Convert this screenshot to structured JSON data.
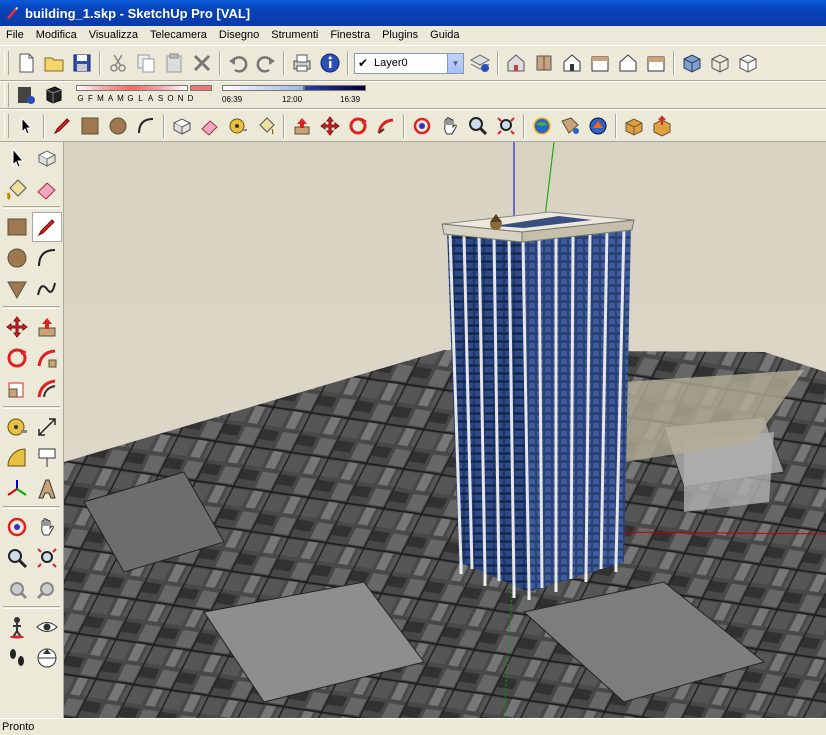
{
  "window": {
    "title": "building_1.skp - SketchUp Pro [VAL]"
  },
  "menu": [
    "File",
    "Modifica",
    "Visualizza",
    "Telecamera",
    "Disegno",
    "Strumenti",
    "Finestra",
    "Plugins",
    "Guida"
  ],
  "layers": {
    "current": "Layer0"
  },
  "shadow": {
    "months": [
      "G",
      "F",
      "M",
      "A",
      "M",
      "G",
      "L",
      "A",
      "S",
      "O",
      "N",
      "D"
    ],
    "time_start": "06:39",
    "time_mid": "12:00",
    "time_end": "16:39"
  },
  "status": {
    "text": "Pronto"
  },
  "colors": {
    "titlebar": "#0a46c4",
    "sky": "#dcd6c6",
    "building_glass": "#1d3566",
    "axis_red": "#c00000",
    "axis_green": "#00a000",
    "axis_blue": "#0000cc"
  }
}
